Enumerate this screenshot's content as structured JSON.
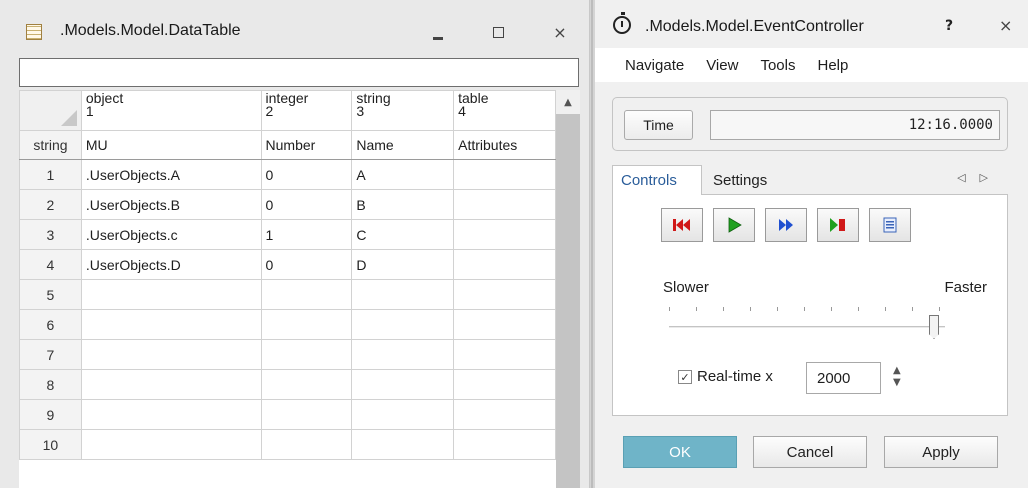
{
  "datatable_window": {
    "title": ".Models.Model.DataTable",
    "formula_value": "",
    "corner_row_label": "string",
    "columns": [
      {
        "type": "object",
        "index": "1",
        "name": "MU"
      },
      {
        "type": "integer",
        "index": "2",
        "name": "Number"
      },
      {
        "type": "string",
        "index": "3",
        "name": "Name"
      },
      {
        "type": "table",
        "index": "4",
        "name": "Attributes"
      }
    ],
    "rows": [
      {
        "n": "1",
        "cells": [
          ".UserObjects.A",
          "0",
          "A",
          ""
        ]
      },
      {
        "n": "2",
        "cells": [
          ".UserObjects.B",
          "0",
          "B",
          ""
        ]
      },
      {
        "n": "3",
        "cells": [
          ".UserObjects.c",
          "1",
          "C",
          ""
        ]
      },
      {
        "n": "4",
        "cells": [
          ".UserObjects.D",
          "0",
          "D",
          ""
        ]
      },
      {
        "n": "5",
        "cells": [
          "",
          "",
          "",
          ""
        ]
      },
      {
        "n": "6",
        "cells": [
          "",
          "",
          "",
          ""
        ]
      },
      {
        "n": "7",
        "cells": [
          "",
          "",
          "",
          ""
        ]
      },
      {
        "n": "8",
        "cells": [
          "",
          "",
          "",
          ""
        ]
      },
      {
        "n": "9",
        "cells": [
          "",
          "",
          "",
          ""
        ]
      },
      {
        "n": "10",
        "cells": [
          "",
          "",
          "",
          ""
        ]
      }
    ]
  },
  "event_controller": {
    "title": ".Models.Model.EventController",
    "help_glyph": "?",
    "close_glyph": "×",
    "menu": [
      "Navigate",
      "View",
      "Tools",
      "Help"
    ],
    "time_button": "Time",
    "time_value": "12:16.0000",
    "tabs": [
      "Controls",
      "Settings"
    ],
    "speed_slower": "Slower",
    "speed_faster": "Faster",
    "speed_level": 0.96,
    "realtime_checked": true,
    "realtime_label": "Real-time x",
    "realtime_value": "2000",
    "buttons": {
      "ok": "OK",
      "cancel": "Cancel",
      "apply": "Apply"
    },
    "control_icons": [
      "reset-icon",
      "start-icon",
      "fast-forward-icon",
      "step-icon",
      "list-icon"
    ],
    "colors": {
      "ok_button": "#6fb4c8",
      "reset": "#d01818",
      "start": "#20a020",
      "fast": "#2050d0"
    }
  }
}
